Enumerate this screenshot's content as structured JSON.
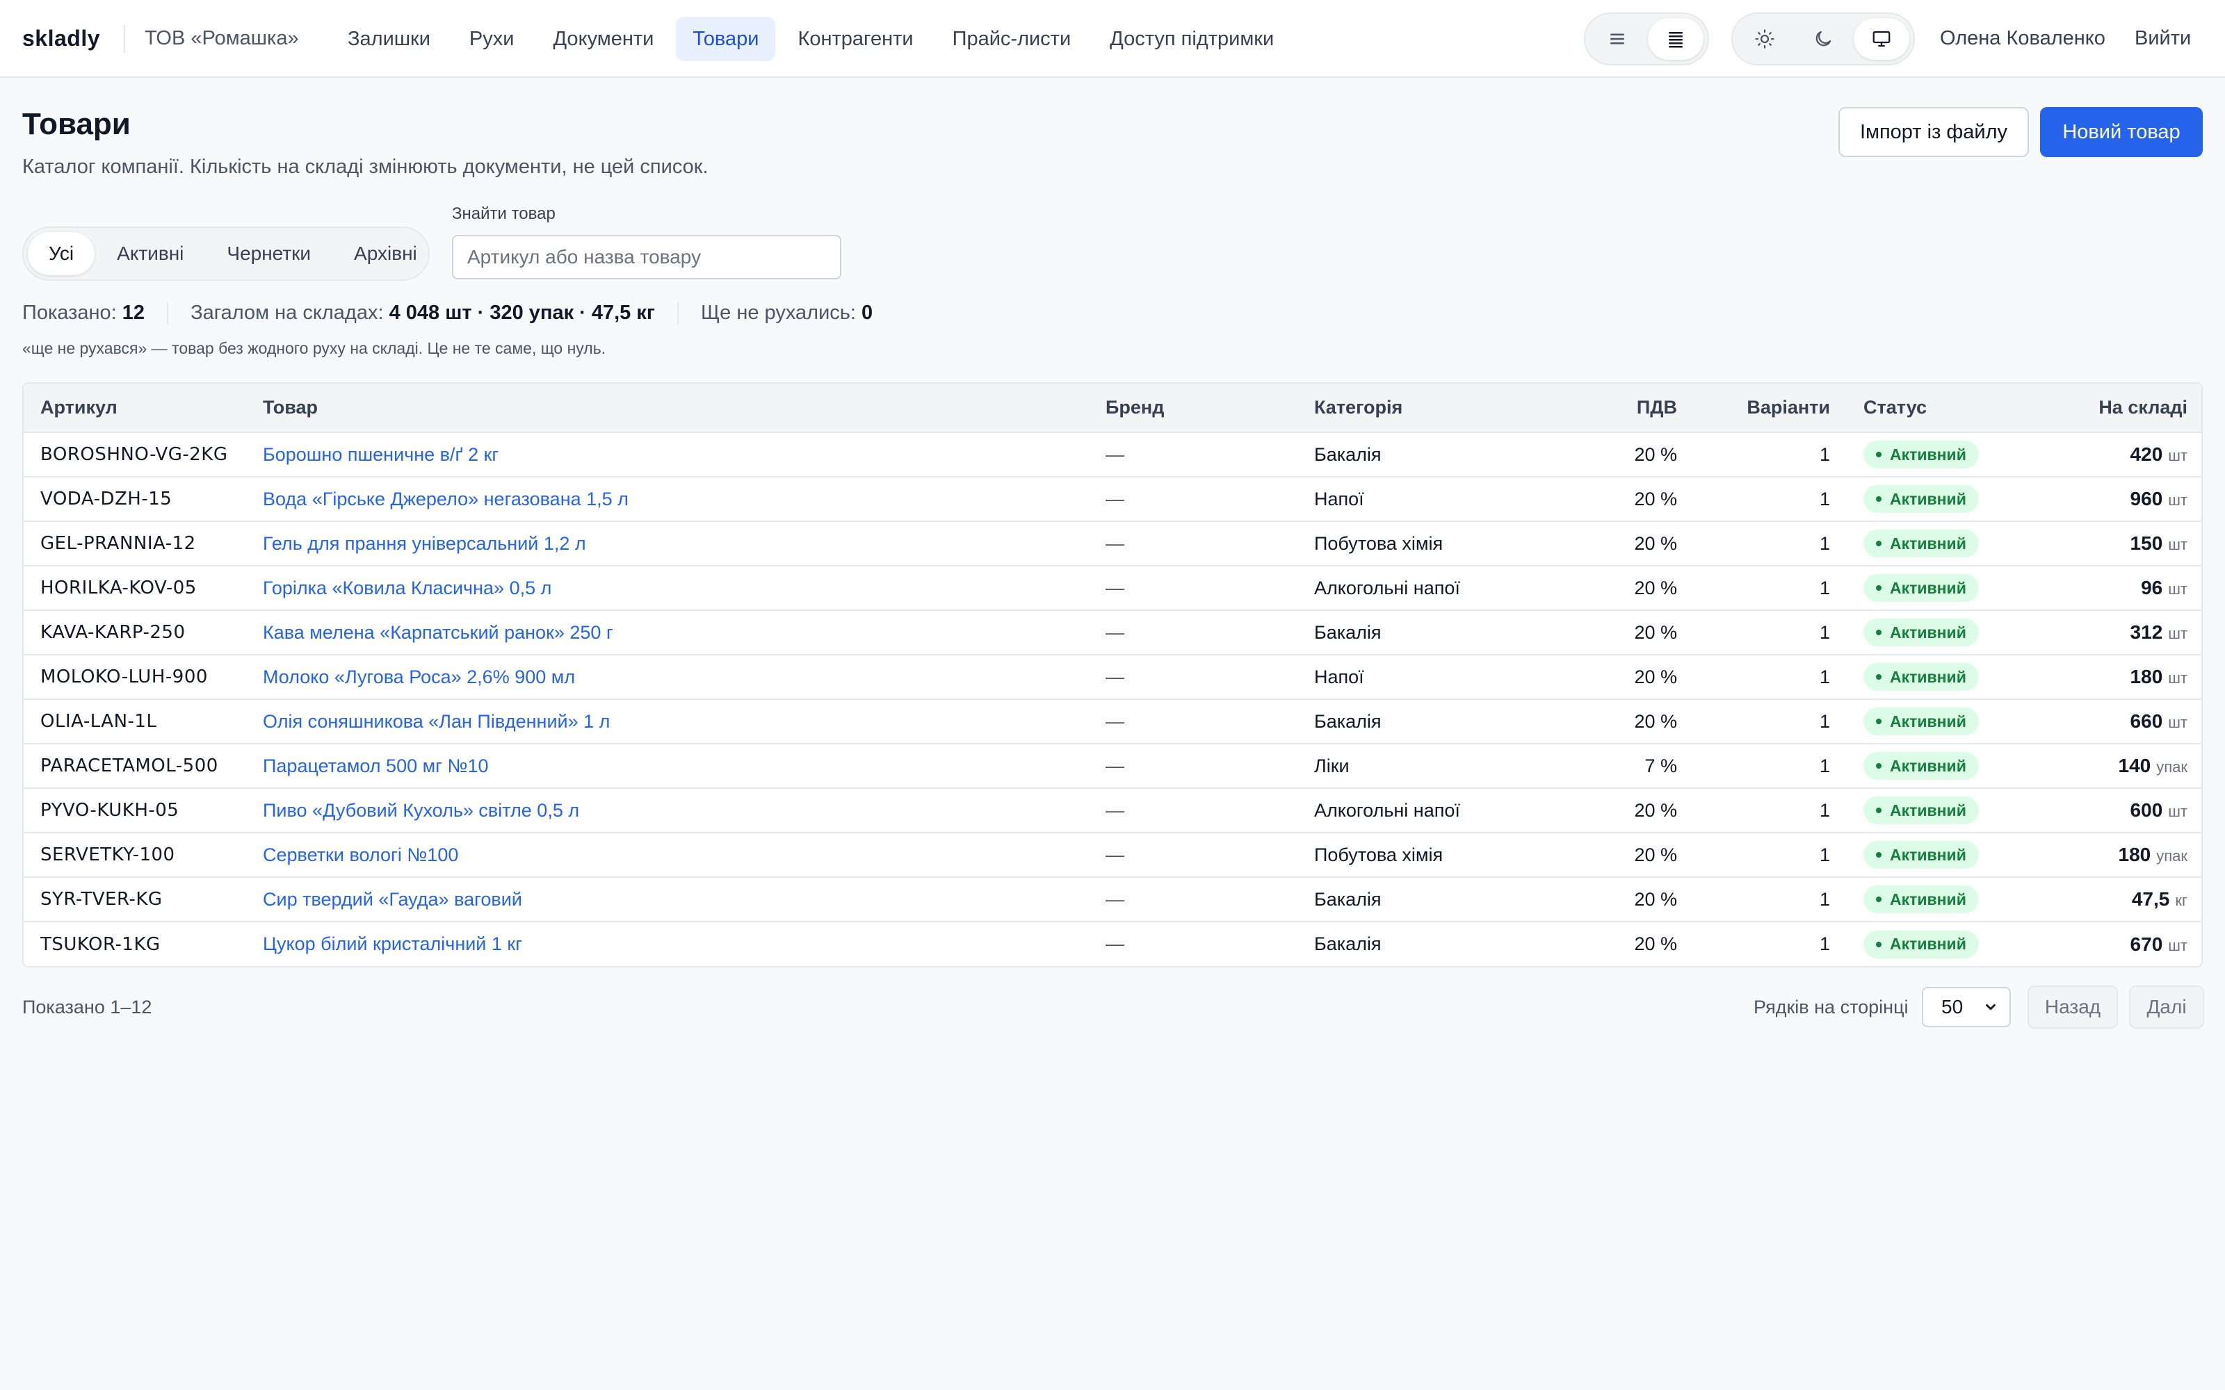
{
  "header": {
    "logo": "skladly",
    "company": "ТОВ «Ромашка»",
    "nav": [
      "Залишки",
      "Рухи",
      "Документи",
      "Товари",
      "Контрагенти",
      "Прайс-листи",
      "Доступ підтримки"
    ],
    "active_nav": "Товари",
    "density_toggle": {
      "options": [
        "list-comfortable-icon",
        "list-compact-icon"
      ],
      "selected": "list-compact-icon"
    },
    "theme_toggle": {
      "options": [
        "sun-icon",
        "moon-icon",
        "monitor-icon"
      ],
      "selected": "monitor-icon"
    },
    "user": "Олена Коваленко",
    "logout": "Вийти"
  },
  "page": {
    "title": "Товари",
    "subtitle": "Каталог компанії. Кількість на складі змінюють документи, не цей список.",
    "import_button": "Імпорт із файлу",
    "new_button": "Новий товар"
  },
  "filters": {
    "tabs": [
      "Усі",
      "Активні",
      "Чернетки",
      "Архівні"
    ],
    "active_tab": "Усі",
    "search_label": "Знайти товар",
    "search_placeholder": "Артикул або назва товару",
    "search_value": ""
  },
  "stats": {
    "shown_label": "Показано:",
    "shown_value": "12",
    "total_label": "Загалом на складах:",
    "total_value": "4 048 шт · 320 упак · 47,5 кг",
    "unmoved_label": "Ще не рухались:",
    "unmoved_value": "0",
    "note": "«ще не рухався» — товар без жодного руху на складі. Це не те саме, що нуль."
  },
  "table": {
    "columns": [
      "Артикул",
      "Товар",
      "Бренд",
      "Категорія",
      "ПДВ",
      "Варіанти",
      "Статус",
      "На складі"
    ],
    "rows": [
      {
        "sku": "BOROSHNO-VG-2KG",
        "name": "Борошно пшеничне в/ґ 2 кг",
        "brand": "—",
        "category": "Бакалія",
        "vat": "20 %",
        "variants": "1",
        "status": "Активний",
        "qty": "420",
        "unit": "шт"
      },
      {
        "sku": "VODA-DZH-15",
        "name": "Вода «Гірське Джерело» негазована 1,5 л",
        "brand": "—",
        "category": "Напої",
        "vat": "20 %",
        "variants": "1",
        "status": "Активний",
        "qty": "960",
        "unit": "шт"
      },
      {
        "sku": "GEL-PRANNIA-12",
        "name": "Гель для прання універсальний 1,2 л",
        "brand": "—",
        "category": "Побутова хімія",
        "vat": "20 %",
        "variants": "1",
        "status": "Активний",
        "qty": "150",
        "unit": "шт"
      },
      {
        "sku": "HORILKA-KOV-05",
        "name": "Горілка «Ковила Класична» 0,5 л",
        "brand": "—",
        "category": "Алкогольні напої",
        "vat": "20 %",
        "variants": "1",
        "status": "Активний",
        "qty": "96",
        "unit": "шт"
      },
      {
        "sku": "KAVA-KARP-250",
        "name": "Кава мелена «Карпатський ранок» 250 г",
        "brand": "—",
        "category": "Бакалія",
        "vat": "20 %",
        "variants": "1",
        "status": "Активний",
        "qty": "312",
        "unit": "шт"
      },
      {
        "sku": "MOLOKO-LUH-900",
        "name": "Молоко «Лугова Роса» 2,6% 900 мл",
        "brand": "—",
        "category": "Напої",
        "vat": "20 %",
        "variants": "1",
        "status": "Активний",
        "qty": "180",
        "unit": "шт"
      },
      {
        "sku": "OLIA-LAN-1L",
        "name": "Олія соняшникова «Лан Південний» 1 л",
        "brand": "—",
        "category": "Бакалія",
        "vat": "20 %",
        "variants": "1",
        "status": "Активний",
        "qty": "660",
        "unit": "шт"
      },
      {
        "sku": "PARACETAMOL-500",
        "name": "Парацетамол 500 мг №10",
        "brand": "—",
        "category": "Ліки",
        "vat": "7 %",
        "variants": "1",
        "status": "Активний",
        "qty": "140",
        "unit": "упак"
      },
      {
        "sku": "PYVO-KUKH-05",
        "name": "Пиво «Дубовий Кухоль» світле 0,5 л",
        "brand": "—",
        "category": "Алкогольні напої",
        "vat": "20 %",
        "variants": "1",
        "status": "Активний",
        "qty": "600",
        "unit": "шт"
      },
      {
        "sku": "SERVETKY-100",
        "name": "Серветки вологі №100",
        "brand": "—",
        "category": "Побутова хімія",
        "vat": "20 %",
        "variants": "1",
        "status": "Активний",
        "qty": "180",
        "unit": "упак"
      },
      {
        "sku": "SYR-TVER-KG",
        "name": "Сир твердий «Гауда» ваговий",
        "brand": "—",
        "category": "Бакалія",
        "vat": "20 %",
        "variants": "1",
        "status": "Активний",
        "qty": "47,5",
        "unit": "кг"
      },
      {
        "sku": "TSUKOR-1KG",
        "name": "Цукор білий кристалічний 1 кг",
        "brand": "—",
        "category": "Бакалія",
        "vat": "20 %",
        "variants": "1",
        "status": "Активний",
        "qty": "670",
        "unit": "шт"
      }
    ]
  },
  "footer": {
    "shown_range": "Показано 1–12",
    "rows_label": "Рядків на сторінці",
    "rows_value": "50",
    "prev": "Назад",
    "next": "Далі"
  },
  "colors": {
    "accent": "#2563eb",
    "status_active_bg": "#dcfce7",
    "status_active_fg": "#15803d"
  }
}
